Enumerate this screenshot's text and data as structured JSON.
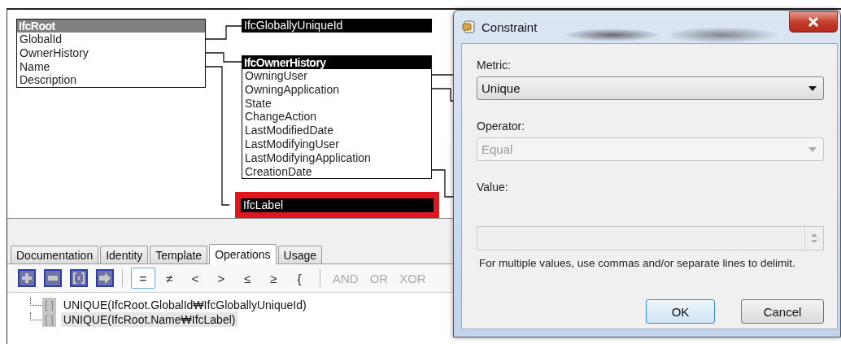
{
  "diagram": {
    "entities": [
      {
        "name": "IfcRoot",
        "kind": "entity",
        "selected": true,
        "highlighted": false,
        "attributes": [
          "GlobalId",
          "OwnerHistory",
          "Name",
          "Description"
        ]
      },
      {
        "name": "IfcGloballyUniqueId",
        "kind": "type",
        "selected": false,
        "highlighted": false
      },
      {
        "name": "IfcOwnerHistory",
        "kind": "entity",
        "selected": false,
        "highlighted": false,
        "attributes": [
          "OwningUser",
          "OwningApplication",
          "State",
          "ChangeAction",
          "LastModifiedDate",
          "LastModifyingUser",
          "LastModifyingApplication",
          "CreationDate"
        ]
      },
      {
        "name": "IfcLabel",
        "kind": "type",
        "selected": false,
        "highlighted": true
      }
    ]
  },
  "tabs": [
    {
      "label": "Documentation",
      "selected": false
    },
    {
      "label": "Identity",
      "selected": false
    },
    {
      "label": "Template",
      "selected": false
    },
    {
      "label": "Operations",
      "selected": true
    },
    {
      "label": "Usage",
      "selected": false
    }
  ],
  "toolbar": {
    "tools": [
      {
        "kind": "add"
      },
      {
        "kind": "remove"
      },
      {
        "kind": "group"
      },
      {
        "kind": "next"
      }
    ],
    "operators": [
      {
        "label": "=",
        "selected": true
      },
      {
        "label": "≠",
        "selected": false
      },
      {
        "label": "<",
        "selected": false
      },
      {
        "label": ">",
        "selected": false
      },
      {
        "label": "≤",
        "selected": false
      },
      {
        "label": "≥",
        "selected": false
      },
      {
        "label": "{",
        "selected": false
      }
    ],
    "logic": [
      {
        "label": "AND",
        "disabled": true
      },
      {
        "label": "OR",
        "disabled": true
      },
      {
        "label": "XOR",
        "disabled": true
      }
    ]
  },
  "constraints": [
    {
      "marker": "[ ]",
      "text": "UNIQUE(IfcRoot.GlobalId₩IfcGloballyUniqueId)",
      "selected": false
    },
    {
      "marker": "[ ]",
      "text": "UNIQUE(IfcRoot.Name₩IfcLabel)",
      "selected": true
    }
  ],
  "dialog": {
    "title": "Constraint",
    "fields": [
      {
        "kind": "dropdown",
        "label": "Metric:",
        "value": "Unique",
        "disabled": false
      },
      {
        "kind": "dropdown",
        "label": "Operator:",
        "value": "Equal",
        "disabled": true
      },
      {
        "kind": "spinner",
        "label": "Value:",
        "disabled": true
      }
    ],
    "hint": "For multiple values, use commas and/or separate lines to delimit.",
    "buttons": [
      {
        "label": "OK",
        "default": true
      },
      {
        "label": "Cancel",
        "default": false
      }
    ]
  }
}
